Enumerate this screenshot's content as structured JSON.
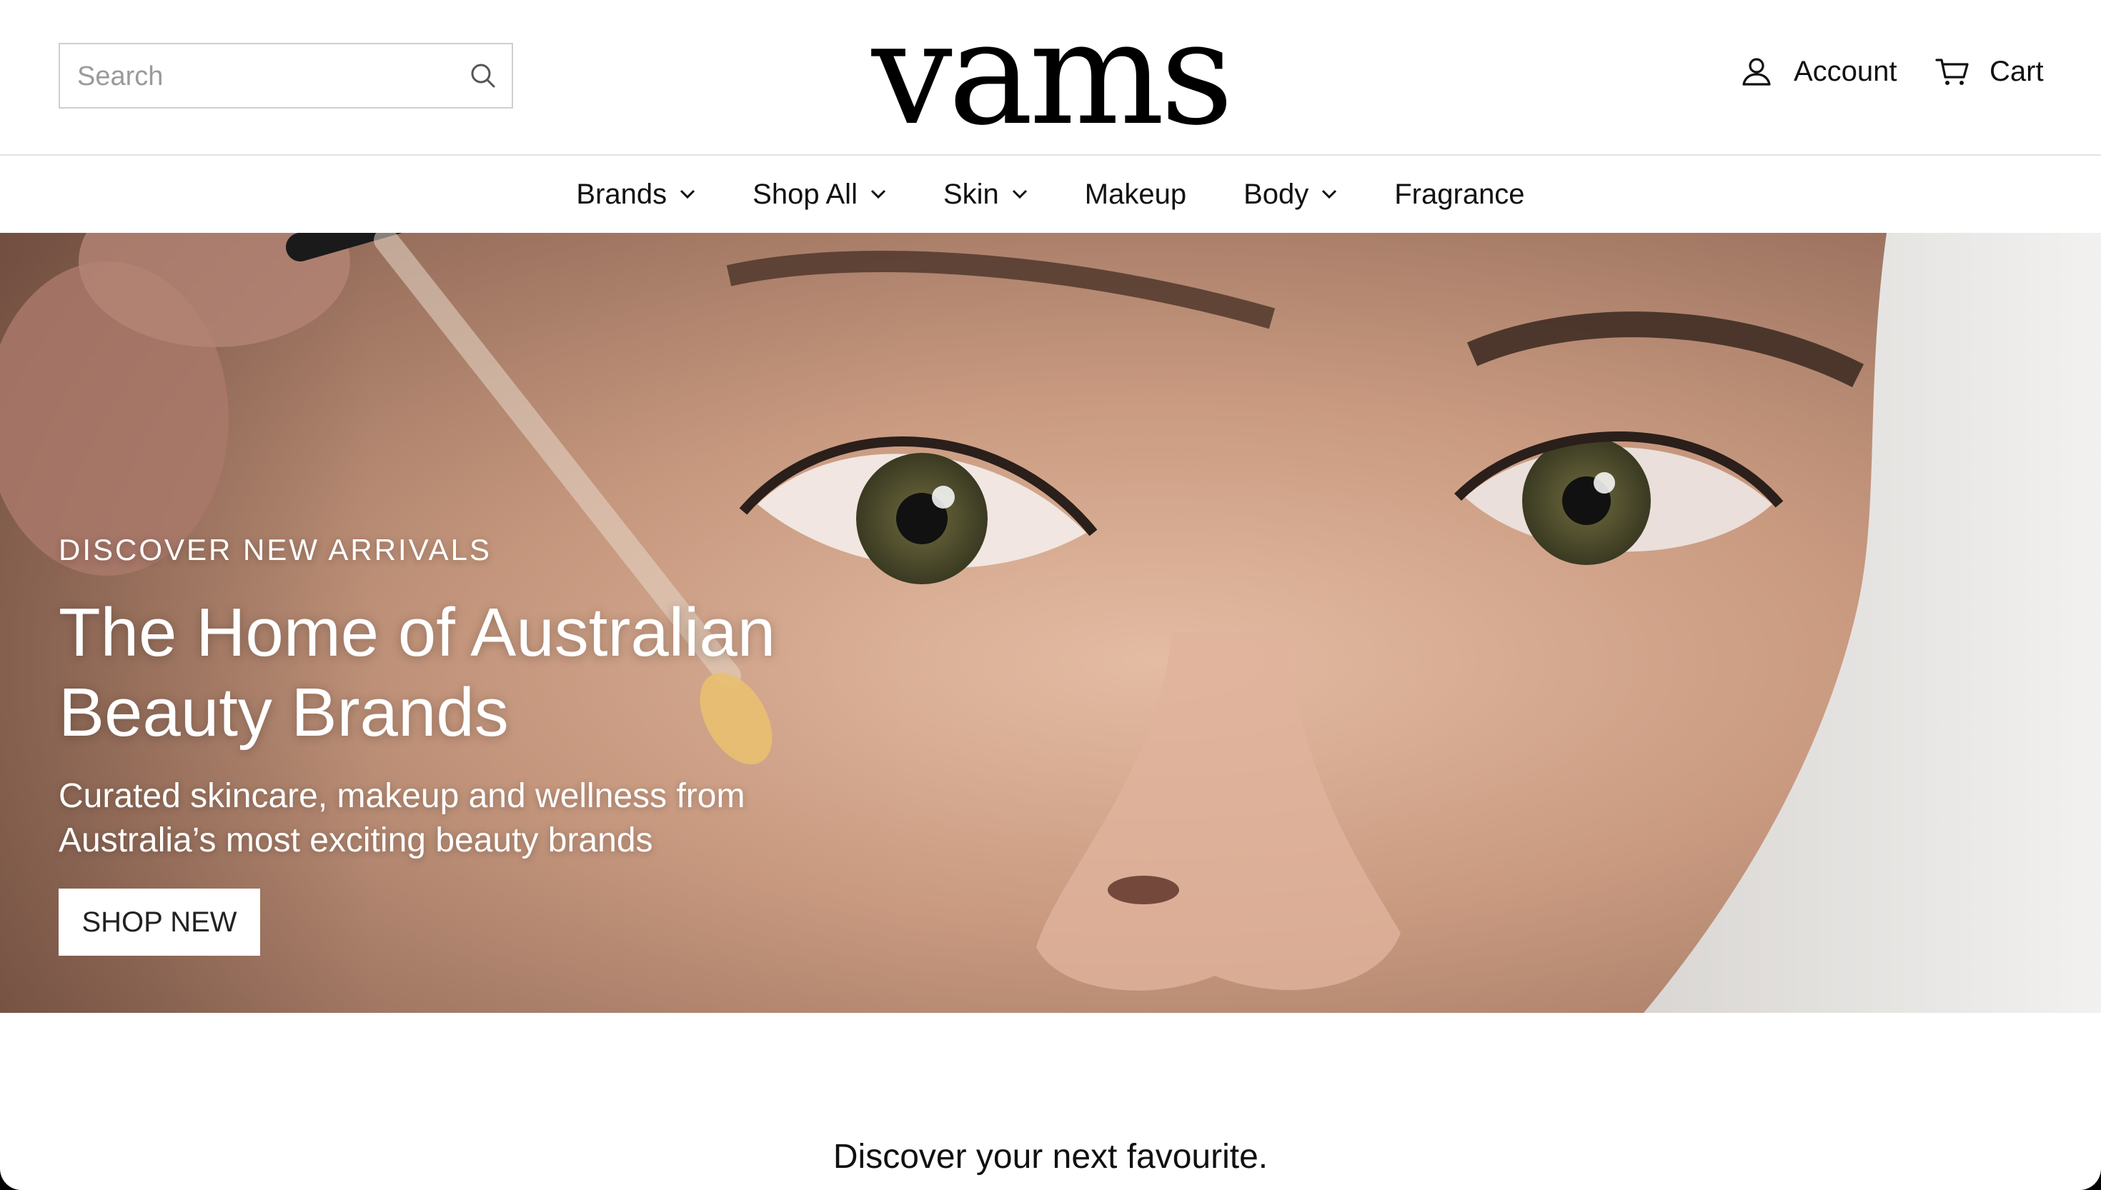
{
  "header": {
    "search": {
      "placeholder": "Search",
      "value": ""
    },
    "logo_text": "vams",
    "account_label": "Account",
    "cart_label": "Cart"
  },
  "nav": {
    "items": [
      {
        "label": "Brands",
        "has_dropdown": true
      },
      {
        "label": "Shop All",
        "has_dropdown": true
      },
      {
        "label": "Skin",
        "has_dropdown": true
      },
      {
        "label": "Makeup",
        "has_dropdown": false
      },
      {
        "label": "Body",
        "has_dropdown": true
      },
      {
        "label": "Fragrance",
        "has_dropdown": false
      }
    ]
  },
  "hero": {
    "eyebrow": "DISCOVER NEW ARRIVALS",
    "title_line1": "The Home of Australian",
    "title_line2": "Beauty Brands",
    "subtitle_line1": "Curated skincare, makeup and wellness from",
    "subtitle_line2": "Australia’s most exciting beauty brands",
    "cta_label": "SHOP NEW"
  },
  "section": {
    "heading": "Discover your next favourite."
  },
  "icons": {
    "search": "search-icon",
    "account": "user-icon",
    "cart": "cart-icon",
    "dropdown": "chevron-down-icon"
  },
  "colors": {
    "text": "#111111",
    "background": "#ffffff",
    "hero_text": "#ffffff",
    "border": "#cfcfcf"
  }
}
